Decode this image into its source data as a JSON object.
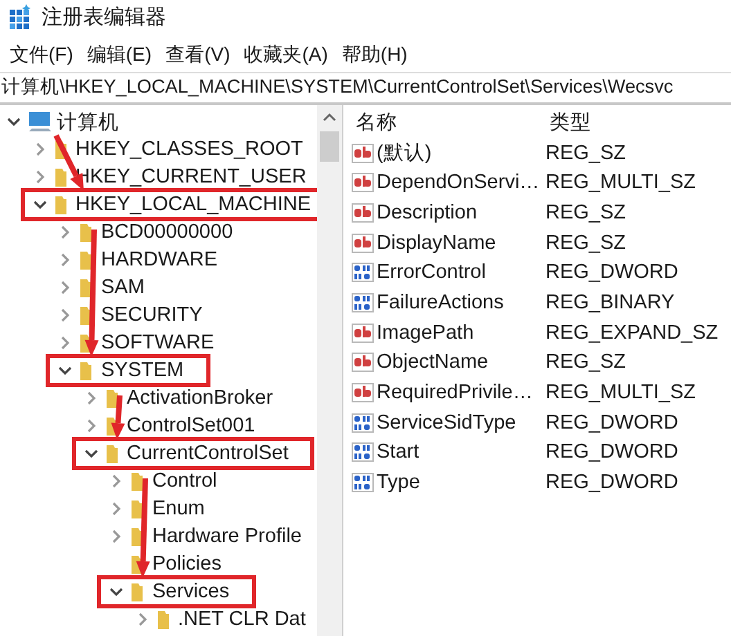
{
  "window": {
    "title": "注册表编辑器"
  },
  "menu": [
    "文件(F)",
    "编辑(E)",
    "查看(V)",
    "收藏夹(A)",
    "帮助(H)"
  ],
  "address": "计算机\\HKEY_LOCAL_MACHINE\\SYSTEM\\CurrentControlSet\\Services\\Wecsvc",
  "tree": {
    "label": "计算机",
    "expanded": true,
    "leaf": false,
    "highlighted": false,
    "children": [
      {
        "label": "HKEY_CLASSES_ROOT",
        "expanded": false,
        "leaf": false,
        "highlighted": false
      },
      {
        "label": "HKEY_CURRENT_USER",
        "expanded": false,
        "leaf": false,
        "highlighted": false
      },
      {
        "label": "HKEY_LOCAL_MACHINE",
        "expanded": true,
        "leaf": false,
        "highlighted": true,
        "children": [
          {
            "label": "BCD00000000",
            "expanded": false,
            "leaf": false,
            "highlighted": false
          },
          {
            "label": "HARDWARE",
            "expanded": false,
            "leaf": false,
            "highlighted": false
          },
          {
            "label": "SAM",
            "expanded": false,
            "leaf": false,
            "highlighted": false
          },
          {
            "label": "SECURITY",
            "expanded": false,
            "leaf": false,
            "highlighted": false
          },
          {
            "label": "SOFTWARE",
            "expanded": false,
            "leaf": false,
            "highlighted": false
          },
          {
            "label": "SYSTEM",
            "expanded": true,
            "leaf": false,
            "highlighted": true,
            "children": [
              {
                "label": "ActivationBroker",
                "expanded": false,
                "leaf": false,
                "highlighted": false
              },
              {
                "label": "ControlSet001",
                "expanded": false,
                "leaf": false,
                "highlighted": false
              },
              {
                "label": "CurrentControlSet",
                "expanded": true,
                "leaf": false,
                "highlighted": true,
                "children": [
                  {
                    "label": "Control",
                    "expanded": false,
                    "leaf": false,
                    "highlighted": false
                  },
                  {
                    "label": "Enum",
                    "expanded": false,
                    "leaf": false,
                    "highlighted": false
                  },
                  {
                    "label": "Hardware Profile",
                    "expanded": false,
                    "leaf": false,
                    "highlighted": false
                  },
                  {
                    "label": "Policies",
                    "leaf": true,
                    "highlighted": false
                  },
                  {
                    "label": "Services",
                    "expanded": true,
                    "leaf": false,
                    "highlighted": true,
                    "children": [
                      {
                        "label": ".NET CLR Dat",
                        "expanded": false,
                        "leaf": false,
                        "highlighted": false
                      }
                    ]
                  }
                ]
              }
            ]
          }
        ]
      }
    ]
  },
  "values": {
    "columns": [
      "名称",
      "类型"
    ],
    "rows": [
      {
        "name": "(默认)",
        "type": "REG_SZ",
        "kind": "string"
      },
      {
        "name": "DependOnServi…",
        "type": "REG_MULTI_SZ",
        "kind": "string"
      },
      {
        "name": "Description",
        "type": "REG_SZ",
        "kind": "string"
      },
      {
        "name": "DisplayName",
        "type": "REG_SZ",
        "kind": "string"
      },
      {
        "name": "ErrorControl",
        "type": "REG_DWORD",
        "kind": "binary"
      },
      {
        "name": "FailureActions",
        "type": "REG_BINARY",
        "kind": "binary"
      },
      {
        "name": "ImagePath",
        "type": "REG_EXPAND_SZ",
        "kind": "string"
      },
      {
        "name": "ObjectName",
        "type": "REG_SZ",
        "kind": "string"
      },
      {
        "name": "RequiredPrivile…",
        "type": "REG_MULTI_SZ",
        "kind": "string"
      },
      {
        "name": "ServiceSidType",
        "type": "REG_DWORD",
        "kind": "binary"
      },
      {
        "name": "Start",
        "type": "REG_DWORD",
        "kind": "binary"
      },
      {
        "name": "Type",
        "type": "REG_DWORD",
        "kind": "binary"
      }
    ]
  }
}
